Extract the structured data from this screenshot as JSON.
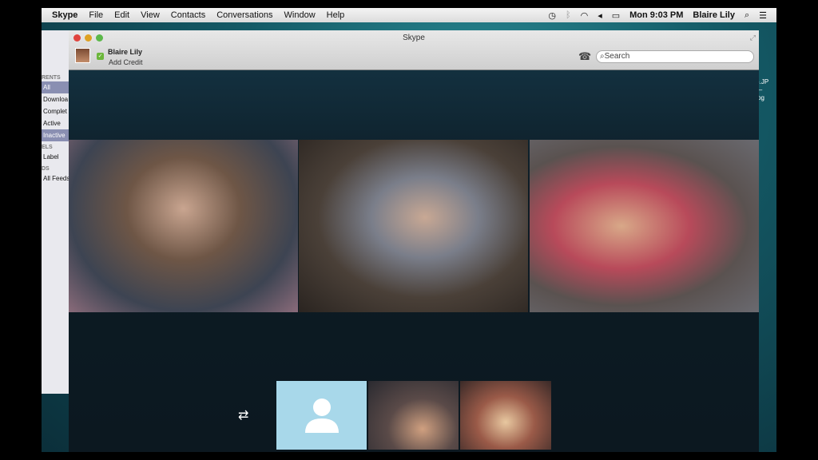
{
  "menubar": {
    "app": "Skype",
    "items": [
      "File",
      "Edit",
      "View",
      "Contacts",
      "Conversations",
      "Window",
      "Help"
    ],
    "clock": "Mon 9:03 PM",
    "user": "Blaire Lily"
  },
  "background_window": {
    "sections": [
      {
        "header": "RENTS",
        "items": [
          "All",
          "Downloa",
          "Complet",
          "Active",
          "Inactive"
        ]
      },
      {
        "header": "ELS",
        "items": [
          "Label"
        ]
      },
      {
        "header": "DS",
        "items": [
          "All Feeds"
        ]
      }
    ],
    "selected": [
      "All",
      "Inactive"
    ]
  },
  "desktop_file": ").JP\nl–\npg",
  "skype": {
    "title": "Skype",
    "user_name": "Blaire Lily",
    "credit_link": "Add Credit",
    "search_placeholder": "Search",
    "status": "online"
  },
  "call": {
    "video_tiles": 3,
    "thumbnails": [
      "avatar-placeholder",
      "video",
      "video"
    ]
  },
  "colors": {
    "status_green": "#6bb63a",
    "avatar_placeholder": "#a8d8ea"
  }
}
